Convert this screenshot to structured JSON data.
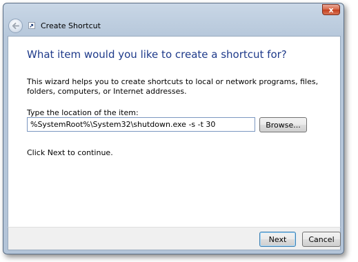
{
  "window": {
    "title": "Create Shortcut",
    "close_label": "x"
  },
  "main": {
    "heading": "What item would you like to create a shortcut for?",
    "description": "This wizard helps you to create shortcuts to local or network programs, files, folders, computers, or Internet addresses.",
    "location_label": "Type the location of the item:",
    "location_value": "%SystemRoot%\\System32\\shutdown.exe -s -t 30",
    "browse_label": "Browse...",
    "next_hint": "Click Next to continue."
  },
  "footer": {
    "next_label": "Next",
    "cancel_label": "Cancel"
  },
  "icons": {
    "back": "back-arrow-icon",
    "app": "shortcut-icon",
    "close": "close-icon"
  },
  "colors": {
    "heading": "#1e3a8a",
    "frame": "#b7c8db",
    "close": "#c4401f"
  }
}
